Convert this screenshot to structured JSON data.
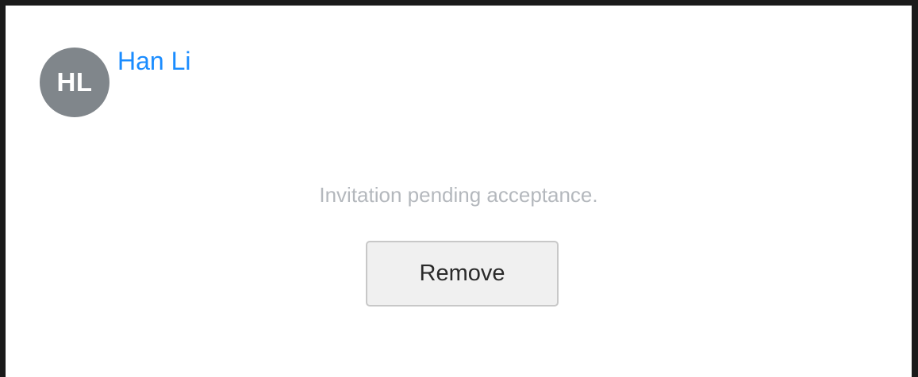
{
  "member": {
    "initials": "HL",
    "name": "Han Li",
    "avatar_color": "#80868b",
    "name_color": "#1a8cff"
  },
  "status": {
    "message": "Invitation pending acceptance."
  },
  "actions": {
    "remove_label": "Remove"
  }
}
